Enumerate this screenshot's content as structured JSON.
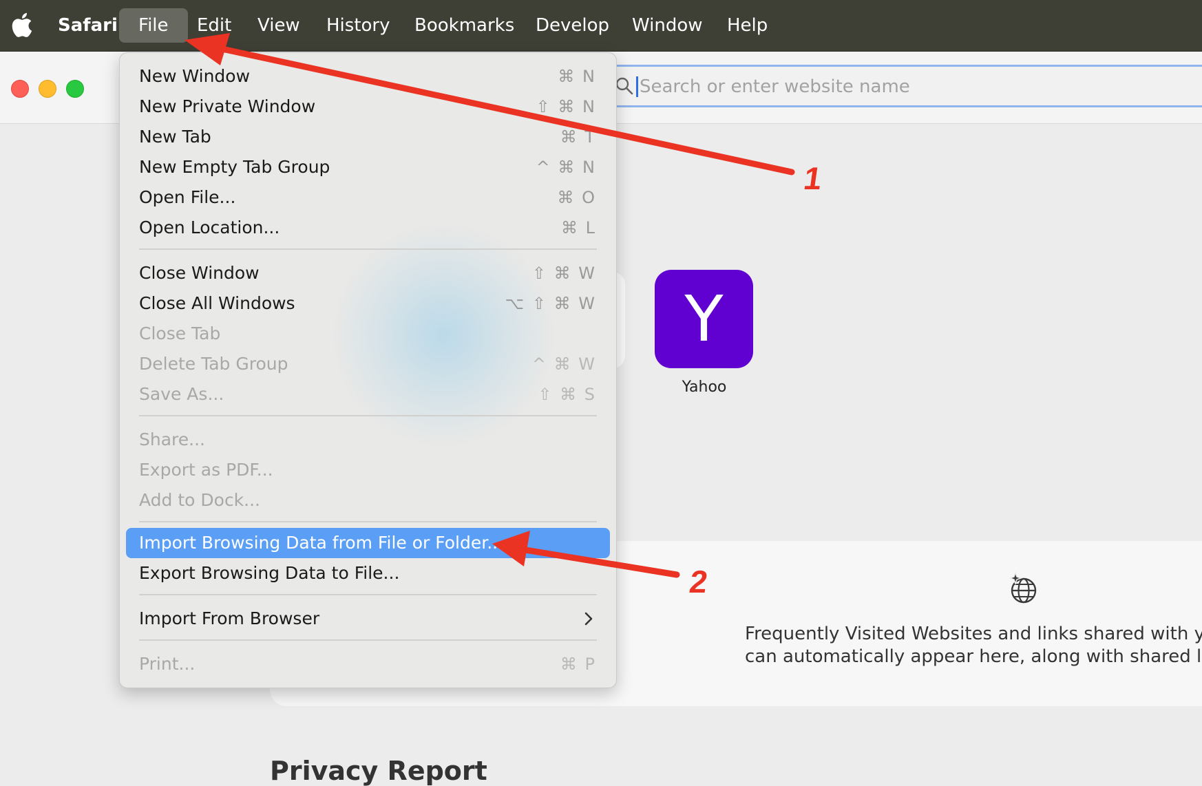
{
  "menubar": {
    "app_name": "Safari",
    "items": [
      "File",
      "Edit",
      "View",
      "History",
      "Bookmarks",
      "Develop",
      "Window",
      "Help"
    ],
    "active_item": "File"
  },
  "toolbar": {
    "search_placeholder": "Search or enter website name"
  },
  "favorites": {
    "tile_letter": "Y",
    "tile_label": "Yahoo",
    "tile_color": "#6001d2"
  },
  "shared_panel": {
    "icon": "globe-sparkle-icon",
    "line1": "Frequently Visited Websites and links shared with you i",
    "line2": "can automatically appear here, along with shared links f"
  },
  "privacy": {
    "heading": "Privacy Report"
  },
  "file_menu": {
    "items": [
      {
        "label": "New Window",
        "shortcut": "⌘ N",
        "enabled": true
      },
      {
        "label": "New Private Window",
        "shortcut": "⇧ ⌘ N",
        "enabled": true
      },
      {
        "label": "New Tab",
        "shortcut": "⌘ T",
        "enabled": true
      },
      {
        "label": "New Empty Tab Group",
        "shortcut": "^ ⌘ N",
        "enabled": true
      },
      {
        "label": "Open File...",
        "shortcut": "⌘ O",
        "enabled": true
      },
      {
        "label": "Open Location...",
        "shortcut": "⌘ L",
        "enabled": true
      },
      {
        "label": "Close Window",
        "shortcut": "⇧ ⌘ W",
        "enabled": true
      },
      {
        "label": "Close All Windows",
        "shortcut": "⌥ ⇧ ⌘ W",
        "enabled": true
      },
      {
        "label": "Close Tab",
        "shortcut": "",
        "enabled": false
      },
      {
        "label": "Delete Tab Group",
        "shortcut": "^ ⌘ W",
        "enabled": false
      },
      {
        "label": "Save As...",
        "shortcut": "⇧ ⌘ S",
        "enabled": false
      },
      {
        "label": "Share...",
        "shortcut": "",
        "enabled": false
      },
      {
        "label": "Export as PDF...",
        "shortcut": "",
        "enabled": false
      },
      {
        "label": "Add to Dock...",
        "shortcut": "",
        "enabled": false
      },
      {
        "label": "Import Browsing Data from File or Folder...",
        "shortcut": "",
        "enabled": true,
        "highlighted": true
      },
      {
        "label": "Export Browsing Data to File...",
        "shortcut": "",
        "enabled": true
      },
      {
        "label": "Import From Browser",
        "shortcut": "",
        "enabled": true,
        "submenu": true
      },
      {
        "label": "Print...",
        "shortcut": "⌘ P",
        "enabled": false
      }
    ]
  },
  "annotations": {
    "step1": "1",
    "step2": "2",
    "arrow_color": "#ea3323"
  }
}
